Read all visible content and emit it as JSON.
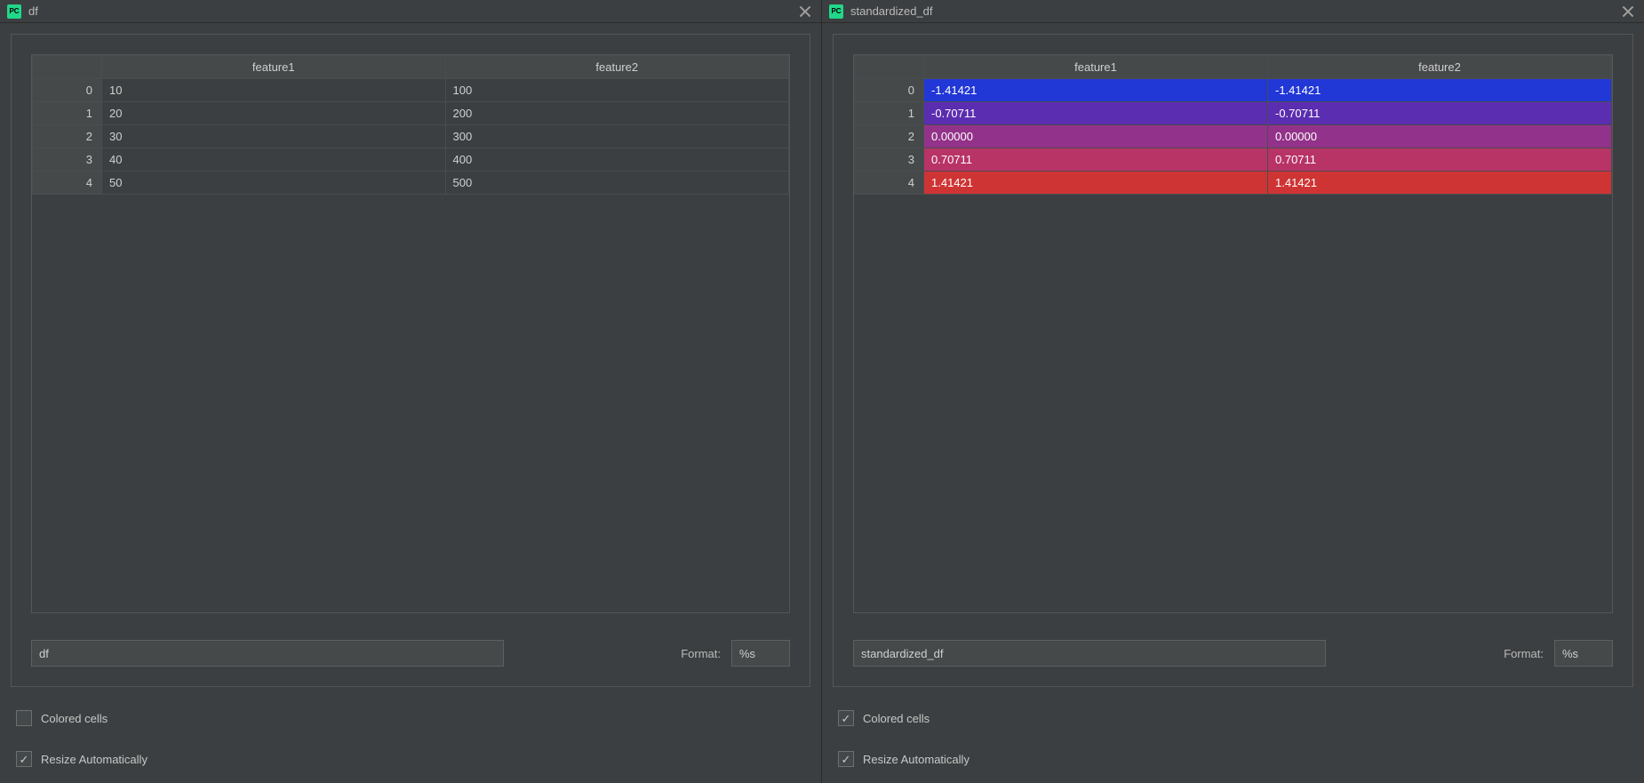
{
  "left": {
    "title": "df",
    "columns": [
      "feature1",
      "feature2"
    ],
    "rows": [
      {
        "idx": "0",
        "cells": [
          "10",
          "100"
        ]
      },
      {
        "idx": "1",
        "cells": [
          "20",
          "200"
        ]
      },
      {
        "idx": "2",
        "cells": [
          "30",
          "300"
        ]
      },
      {
        "idx": "3",
        "cells": [
          "40",
          "400"
        ]
      },
      {
        "idx": "4",
        "cells": [
          "50",
          "500"
        ]
      }
    ],
    "expr": "df",
    "format_label": "Format:",
    "format_value": "%s",
    "colored_label": "Colored cells",
    "colored_checked": false,
    "resize_label": "Resize Automatically",
    "resize_checked": true,
    "row_colors": [
      null,
      null,
      null,
      null,
      null
    ]
  },
  "right": {
    "title": "standardized_df",
    "columns": [
      "feature1",
      "feature2"
    ],
    "rows": [
      {
        "idx": "0",
        "cells": [
          "-1.41421",
          "-1.41421"
        ]
      },
      {
        "idx": "1",
        "cells": [
          "-0.70711",
          "-0.70711"
        ]
      },
      {
        "idx": "2",
        "cells": [
          "0.00000",
          "0.00000"
        ]
      },
      {
        "idx": "3",
        "cells": [
          "0.70711",
          "0.70711"
        ]
      },
      {
        "idx": "4",
        "cells": [
          "1.41421",
          "1.41421"
        ]
      }
    ],
    "expr": "standardized_df",
    "format_label": "Format:",
    "format_value": "%s",
    "colored_label": "Colored cells",
    "colored_checked": true,
    "resize_label": "Resize Automatically",
    "resize_checked": true,
    "row_colors": [
      "#2137d6",
      "#5b2db0",
      "#93328a",
      "#b83366",
      "#cf3434"
    ]
  }
}
